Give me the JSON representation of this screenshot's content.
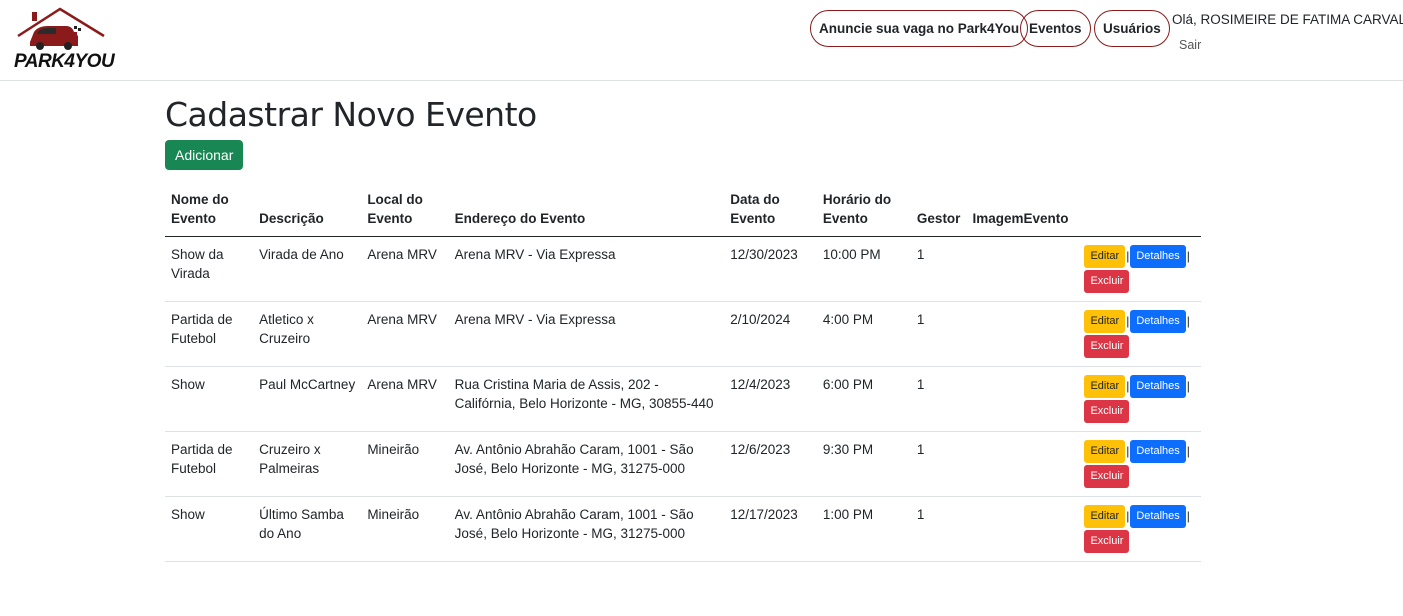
{
  "brand": {
    "logo_text": "PARK4YOU",
    "accent_color": "#8b1a1a"
  },
  "nav": {
    "items": [
      "Anuncie sua vaga no Park4You",
      "Eventos",
      "Usuários"
    ],
    "greeting": "Olá, ROSIMEIRE DE FATIMA CARVALHO",
    "logout": "Sair"
  },
  "page": {
    "title": "Cadastrar Novo Evento",
    "add_button": "Adicionar"
  },
  "table": {
    "headers": [
      "Nome do Evento",
      "Descrição",
      "Local do Evento",
      "Endereço do Evento",
      "Data do Evento",
      "Horário do Evento",
      "Gestor",
      "ImagemEvento",
      ""
    ],
    "actions": {
      "edit": "Editar",
      "details": "Detalhes",
      "delete": "Excluir",
      "separator": "|"
    },
    "rows": [
      {
        "nome": "Show da Virada",
        "descricao": "Virada de Ano",
        "local": "Arena MRV",
        "endereco": "Arena MRV - Via Expressa",
        "data": "12/30/2023",
        "horario": "10:00 PM",
        "gestor": "1",
        "imagem": ""
      },
      {
        "nome": "Partida de Futebol",
        "descricao": "Atletico x Cruzeiro",
        "local": "Arena MRV",
        "endereco": "Arena MRV - Via Expressa",
        "data": "2/10/2024",
        "horario": "4:00 PM",
        "gestor": "1",
        "imagem": ""
      },
      {
        "nome": "Show",
        "descricao": "Paul McCartney",
        "local": "Arena MRV",
        "endereco": "Rua Cristina Maria de Assis, 202 - Califórnia, Belo Horizonte - MG, 30855-440",
        "data": "12/4/2023",
        "horario": "6:00 PM",
        "gestor": "1",
        "imagem": ""
      },
      {
        "nome": "Partida de Futebol",
        "descricao": "Cruzeiro x Palmeiras",
        "local": "Mineirão",
        "endereco": "Av. Antônio Abrahão Caram, 1001 - São José, Belo Horizonte - MG, 31275-000",
        "data": "12/6/2023",
        "horario": "9:30 PM",
        "gestor": "1",
        "imagem": ""
      },
      {
        "nome": "Show",
        "descricao": "Último Samba do Ano",
        "local": "Mineirão",
        "endereco": "Av. Antônio Abrahão Caram, 1001 - São José, Belo Horizonte - MG, 31275-000",
        "data": "12/17/2023",
        "horario": "1:00 PM",
        "gestor": "1",
        "imagem": ""
      }
    ]
  }
}
